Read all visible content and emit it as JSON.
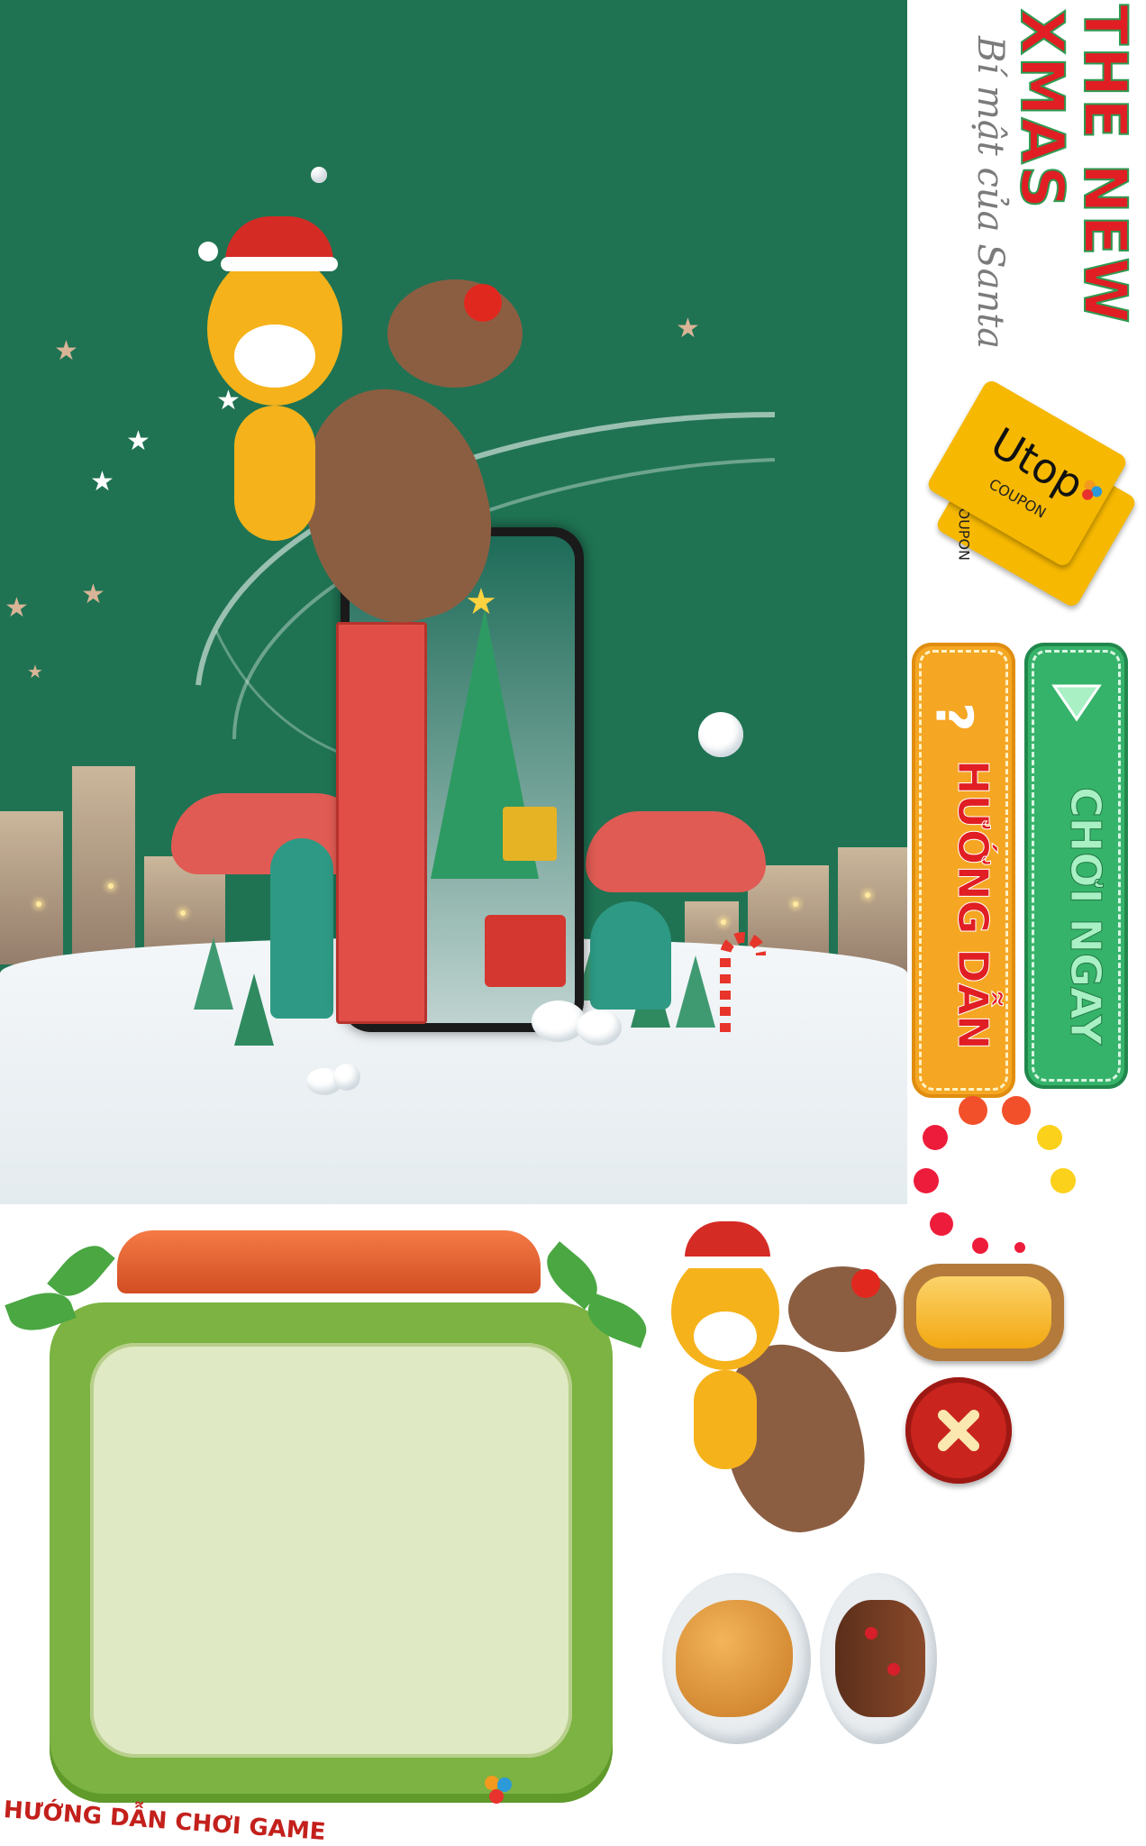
{
  "title": {
    "line1": "THE NEW",
    "line2": "XMAS",
    "subtitle": "Bí mật của Santa"
  },
  "coupon": {
    "brand": "Utop",
    "label": "COUPON",
    "label_back": "COUPON"
  },
  "buttons": {
    "guide_icon": "?",
    "guide_label": "HƯỚNG DẪN",
    "play_label": "CHƠI NGAY"
  },
  "panel": {
    "caption": "HƯỚNG DẪN CHƠI GAME"
  },
  "colors": {
    "scene_bg": "#1f7353",
    "title_red": "#e01e24",
    "title_green": "#2f9a52",
    "guide_orange": "#f5a623",
    "play_green": "#36b36a",
    "coupon_yellow": "#f6b800",
    "close_red": "#c9241e",
    "panel_green": "#7cb342",
    "panel_inner": "#dfe9c3"
  },
  "icons": [
    "question-icon",
    "play-icon",
    "close-icon",
    "loading-dots-icon",
    "utop-logo-icon"
  ]
}
